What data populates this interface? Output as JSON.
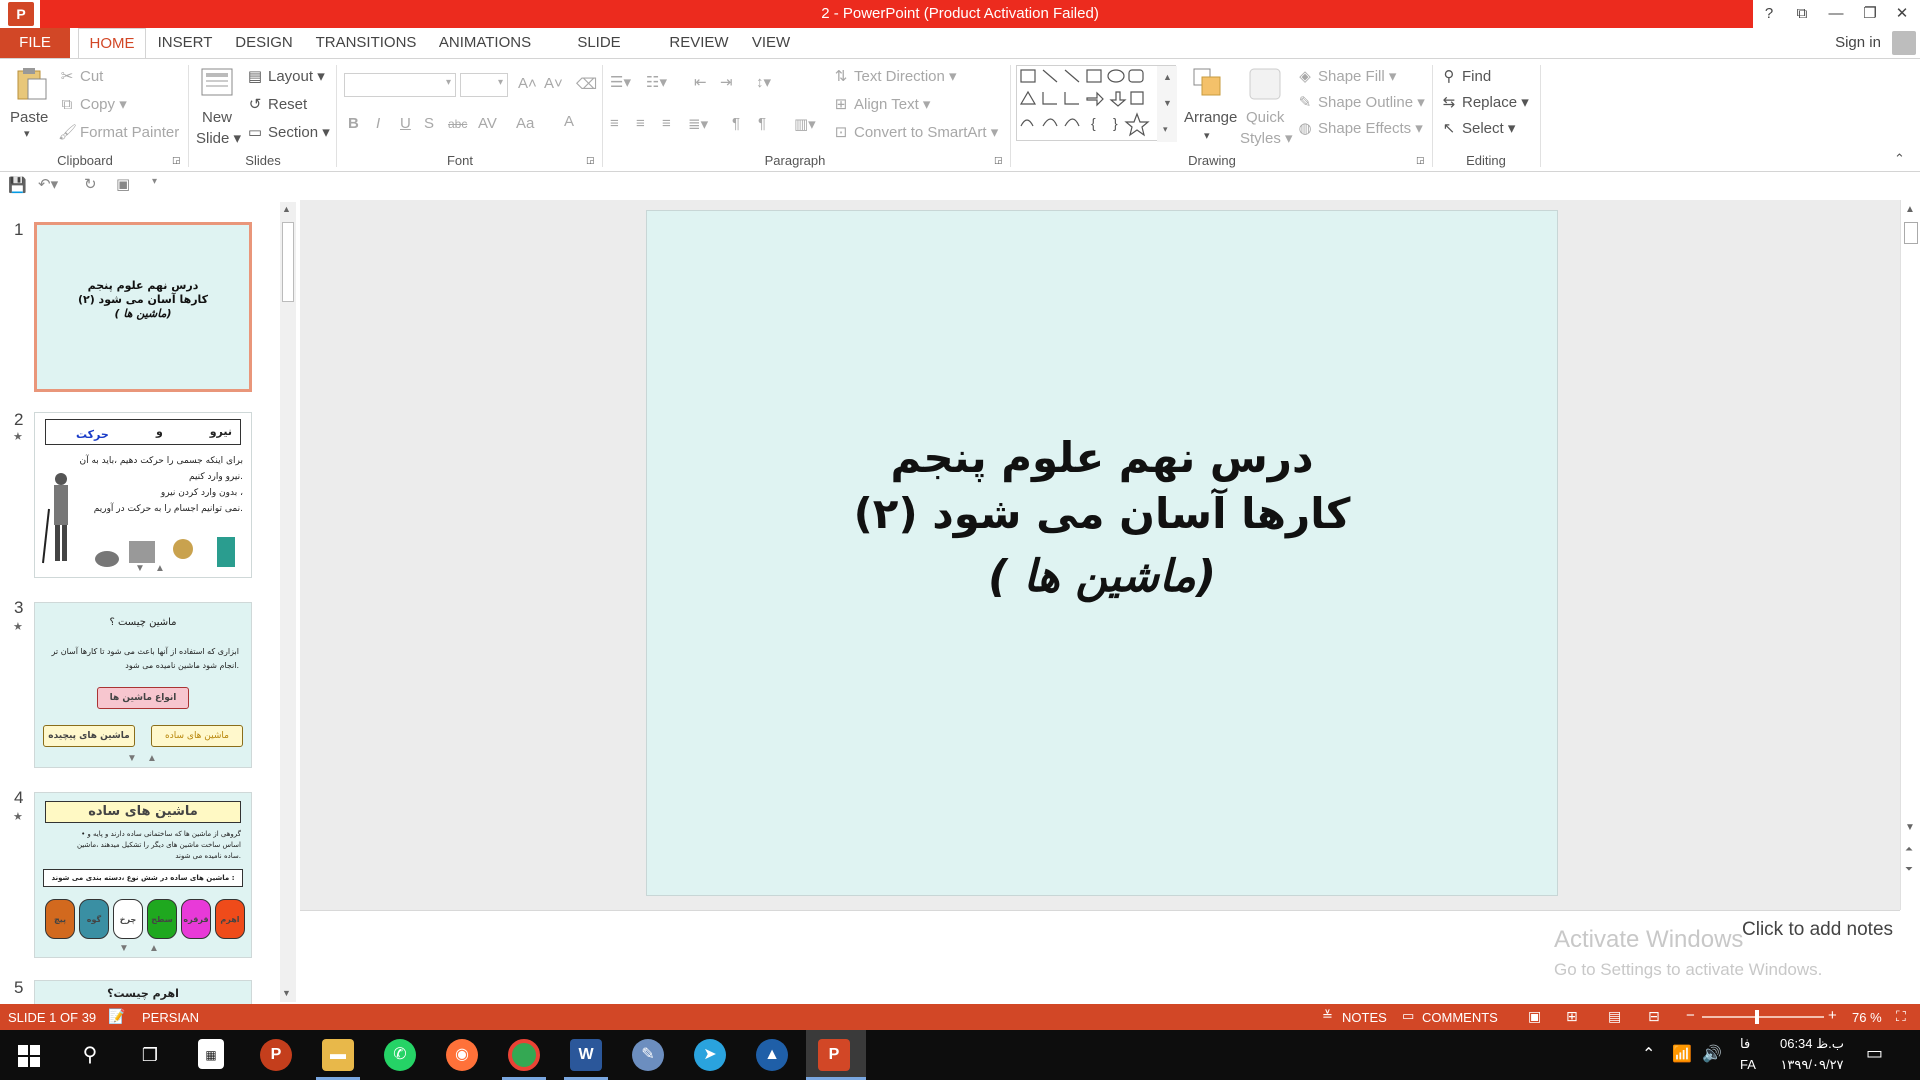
{
  "window": {
    "title": "2 -  PowerPoint (Product Activation Failed)",
    "app_letter": "P",
    "help": "?",
    "ribbon_display": "⧉",
    "minimize": "—",
    "restore": "❐",
    "close": "✕"
  },
  "tabs": [
    "FILE",
    "HOME",
    "INSERT",
    "DESIGN",
    "TRANSITIONS",
    "ANIMATIONS",
    "SLIDE SHOW",
    "REVIEW",
    "VIEW"
  ],
  "sign_in": "Sign in",
  "ribbon": {
    "clipboard": {
      "paste": "Paste",
      "cut": "Cut",
      "copy": "Copy",
      "format_painter": "Format Painter",
      "label": "Clipboard"
    },
    "slides": {
      "new_slide_1": "New",
      "new_slide_2": "Slide",
      "layout": "Layout",
      "reset": "Reset",
      "section": "Section",
      "label": "Slides"
    },
    "font": {
      "label": "Font",
      "bold": "B",
      "italic": "I",
      "underline": "U",
      "shadow": "S",
      "strike": "abc",
      "spacing": "AV",
      "case": "Aa",
      "color": "A",
      "grow": "A˄",
      "shrink": "A˅"
    },
    "paragraph": {
      "text_direction": "Text Direction",
      "align_text": "Align Text",
      "convert_smartart": "Convert to SmartArt",
      "label": "Paragraph"
    },
    "drawing": {
      "arrange": "Arrange",
      "quick_styles_1": "Quick",
      "quick_styles_2": "Styles",
      "shape_fill": "Shape Fill",
      "shape_outline": "Shape Outline",
      "shape_effects": "Shape Effects",
      "label": "Drawing"
    },
    "editing": {
      "find": "Find",
      "replace": "Replace",
      "select": "Select",
      "label": "Editing"
    }
  },
  "thumbnails": {
    "numbers": [
      "1",
      "2",
      "3",
      "4",
      "5"
    ],
    "star": "★",
    "s1": {
      "line1": "درس نهم علوم پنجم",
      "line2": "کارها  آسان می شود (۲)",
      "line3": "( ماشین ها)"
    },
    "s2": {
      "title_a": "نیرو",
      "title_b": "و",
      "title_c": "حرکت",
      "t1": "برای اینکه جسمی را حرکت دهیم ،باید به آن",
      "t2": "نیرو وارد کنیم.",
      "t3": "بدون وارد کردن نیرو ،",
      "t4": "نمی توانیم اجسام را به حرکت در آوریم."
    },
    "s3": {
      "title": "ماشین چیست ؟",
      "t1": "ابزاری که استفاده از آنها باعث می شود تا کارها آسان تر",
      "t2": "انجام شود ماشین  نامیده می شود.",
      "box_main": "انواع ماشین ها",
      "box_left": "ماشین های پیچیده",
      "box_right": "ماشین های ساده"
    },
    "s4": {
      "title": "ماشین های ساده",
      "t1": "• گروهی از ماشین ها که ساختمانی ساده دارند و پایه و",
      "t2": "اساس ساخت ماشین های دیگر را تشکیل میدهند ،ماشین",
      "t3": "ساده نامیده می شوند.",
      "band": "ماشین های ساده در شش نوع ،دسته بندی می شوند :",
      "items": [
        "پیچ",
        "گوه",
        "چرخ",
        "قرقره",
        "سطح",
        "اهرم"
      ]
    },
    "s5": {
      "title": "اهرم چیست؟"
    }
  },
  "slide": {
    "line1": "درس نهم علوم پنجم",
    "line2": "کارها  آسان می شود (۲)",
    "line3": "( ماشین ها)"
  },
  "notes_placeholder": "Click to add notes",
  "watermark": {
    "line1": "Activate Windows",
    "line2": "Go to Settings to activate Windows."
  },
  "status": {
    "slide_count": "SLIDE 1 OF 39",
    "language": "PERSIAN",
    "notes": "NOTES",
    "comments": "COMMENTS",
    "zoom": "76 %",
    "zoom_fraction": 0.45
  },
  "taskbar": {
    "time": "06:34 ب.ظ",
    "date": "۱۳۹۹/۰۹/۲۷",
    "lang_fa": "فا",
    "lang_code": "FA"
  },
  "colors": {
    "accent": "#d24726",
    "title_red": "#ec2b1e",
    "slide_bg": "#dff3f2"
  }
}
